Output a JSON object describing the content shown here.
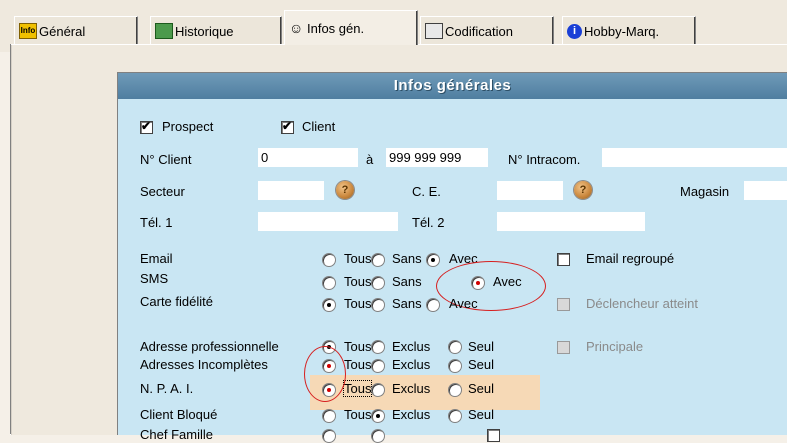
{
  "tabs": [
    {
      "label": "Général",
      "icon": "info-icon"
    },
    {
      "label": "Historique",
      "icon": "historique-icon"
    },
    {
      "label": "Infos gén.",
      "icon": "people-icon"
    },
    {
      "label": "Codification",
      "icon": "codification-icon"
    },
    {
      "label": "Hobby-Marq.",
      "icon": "info-circle-icon"
    }
  ],
  "panel_title": "Infos générales",
  "checks": {
    "prospect": "Prospect",
    "client": "Client"
  },
  "fields": {
    "n_client_label": "N° Client",
    "n_client_from": "0",
    "a_label": "à",
    "n_client_to": "999 999 999",
    "n_intracom_label": "N° Intracom.",
    "n_intracom_value": "",
    "secteur_label": "Secteur",
    "secteur_value": "",
    "ce_label": "C. E.",
    "ce_value": "",
    "magasin_label": "Magasin",
    "magasin_value": "",
    "tel1_label": "Tél. 1",
    "tel1_value": "",
    "tel2_label": "Tél. 2",
    "tel2_value": ""
  },
  "options": {
    "tous": "Tous",
    "sans": "Sans",
    "avec": "Avec",
    "exclus": "Exclus",
    "seul": "Seul"
  },
  "rows": {
    "email": "Email",
    "sms": "SMS",
    "carte": "Carte fidélité",
    "adresse_pro": "Adresse professionnelle",
    "adresses_incompletes": "Adresses Incomplètes",
    "npai": "N. P. A. I.",
    "client_bloque": "Client Bloqué",
    "chef_famille": "Chef Famille"
  },
  "side_checks": {
    "email_regroupe": "Email regroupé",
    "declencheur": "Déclencheur atteint",
    "principale": "Principale"
  }
}
